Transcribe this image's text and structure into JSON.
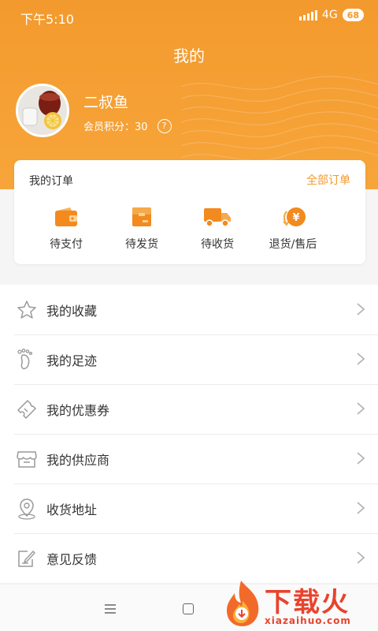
{
  "status_bar": {
    "time": "下午5:10",
    "network": "4G",
    "battery": "68"
  },
  "header": {
    "title": "我的"
  },
  "profile": {
    "name": "二叔鱼",
    "points_label": "会员积分：30",
    "help_icon": "question-circle-icon"
  },
  "orders": {
    "title": "我的订单",
    "all_link": "全部订单",
    "items": [
      {
        "label": "待支付",
        "icon": "wallet-icon"
      },
      {
        "label": "待发货",
        "icon": "package-box-icon"
      },
      {
        "label": "待收货",
        "icon": "delivery-truck-icon"
      },
      {
        "label": "退货/售后",
        "icon": "yen-refund-icon"
      }
    ]
  },
  "menu": {
    "items": [
      {
        "label": "我的收藏",
        "icon": "star-icon"
      },
      {
        "label": "我的足迹",
        "icon": "footprint-icon"
      },
      {
        "label": "我的优惠券",
        "icon": "coupon-icon"
      },
      {
        "label": "我的供应商",
        "icon": "store-icon"
      },
      {
        "label": "收货地址",
        "icon": "location-pin-icon"
      },
      {
        "label": "意见反馈",
        "icon": "feedback-edit-icon"
      }
    ]
  },
  "watermark": {
    "brand": "下载火",
    "url": "xiazaihuo.com"
  },
  "colors": {
    "accent": "#f39a2e",
    "text": "#333333",
    "watermark": "#e8432d"
  }
}
